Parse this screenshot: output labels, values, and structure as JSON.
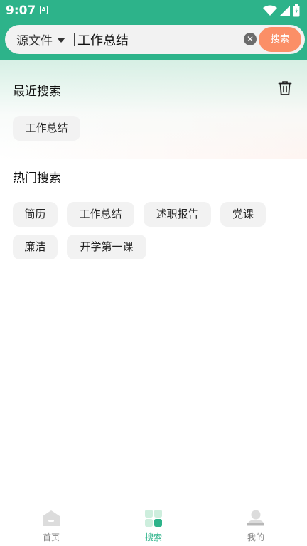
{
  "status_bar": {
    "time": "9:07",
    "notification_icon": "A"
  },
  "search": {
    "source_label": "源文件",
    "query_value": "工作总结",
    "clear_icon": "close-circle-icon",
    "search_button_label": "搜索"
  },
  "recent": {
    "title": "最近搜索",
    "delete_icon": "trash-icon",
    "items": [
      "工作总结"
    ]
  },
  "hot": {
    "title": "热门搜索",
    "items": [
      "简历",
      "工作总结",
      "述职报告",
      "党课",
      "廉洁",
      "开学第一课"
    ]
  },
  "bottom_nav": {
    "items": [
      {
        "label": "首页",
        "icon": "home-icon",
        "active": false
      },
      {
        "label": "搜索",
        "icon": "grid-icon",
        "active": true
      },
      {
        "label": "我的",
        "icon": "user-icon",
        "active": false
      }
    ]
  },
  "colors": {
    "accent": "#2db38a",
    "search_button": "#fb8f67",
    "chip_bg": "#f2f2f2"
  }
}
